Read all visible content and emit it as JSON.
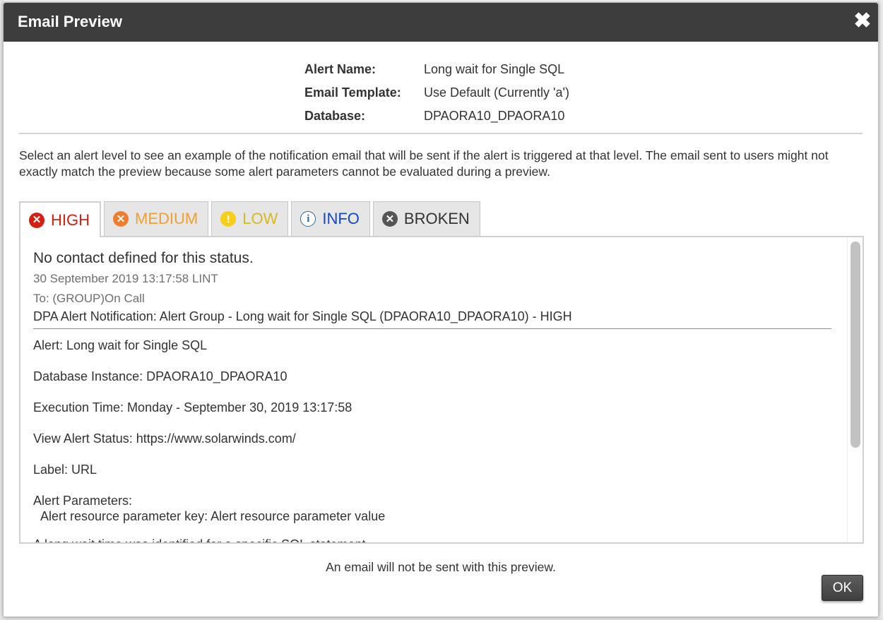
{
  "dialog": {
    "title": "Email Preview",
    "close_glyph": "✖"
  },
  "meta": [
    {
      "label": "Alert Name:",
      "value": "Long wait for Single SQL"
    },
    {
      "label": "Email Template:",
      "value": "Use Default (Currently 'a')"
    },
    {
      "label": "Database:",
      "value": "DPAORA10_DPAORA10"
    }
  ],
  "description": "Select an alert level to see an example of the notification email that will be sent if the alert is triggered at that level. The email sent to users might not exactly match the preview because some alert parameters cannot be evaluated during a preview.",
  "tabs": [
    {
      "label": "HIGH",
      "icon": "x-circle-icon",
      "glyph": "✕",
      "active": true,
      "color": "#d32011"
    },
    {
      "label": "MEDIUM",
      "icon": "x-circle-icon",
      "glyph": "✕",
      "active": false,
      "color": "#f0a030"
    },
    {
      "label": "LOW",
      "icon": "exclamation-circle-icon",
      "glyph": "!",
      "active": false,
      "color": "#d8b720"
    },
    {
      "label": "INFO",
      "icon": "info-circle-icon",
      "glyph": "i",
      "active": false,
      "color": "#1446c8"
    },
    {
      "label": "BROKEN",
      "icon": "x-circle-icon",
      "glyph": "✕",
      "active": false,
      "color": "#333333"
    }
  ],
  "preview": {
    "subject": "No contact defined for this status.",
    "date": "30 September 2019 13:17:58 LINT",
    "to": "To: (GROUP)On Call",
    "headline": "DPA Alert Notification: Alert Group - Long wait for Single SQL (DPAORA10_DPAORA10) - HIGH",
    "body": [
      "Alert: Long wait for Single SQL",
      "Database Instance: DPAORA10_DPAORA10",
      "Execution Time: Monday - September 30, 2019 13:17:58",
      "View Alert Status: https://www.solarwinds.com/",
      "Label: URL",
      "Alert Parameters:"
    ],
    "param_line": "Alert resource parameter key: Alert resource parameter value",
    "cutoff_line": "A long wait time was identified for a specific SQL statement"
  },
  "footer": {
    "note": "An email will not be sent with this preview.",
    "ok_label": "OK"
  }
}
